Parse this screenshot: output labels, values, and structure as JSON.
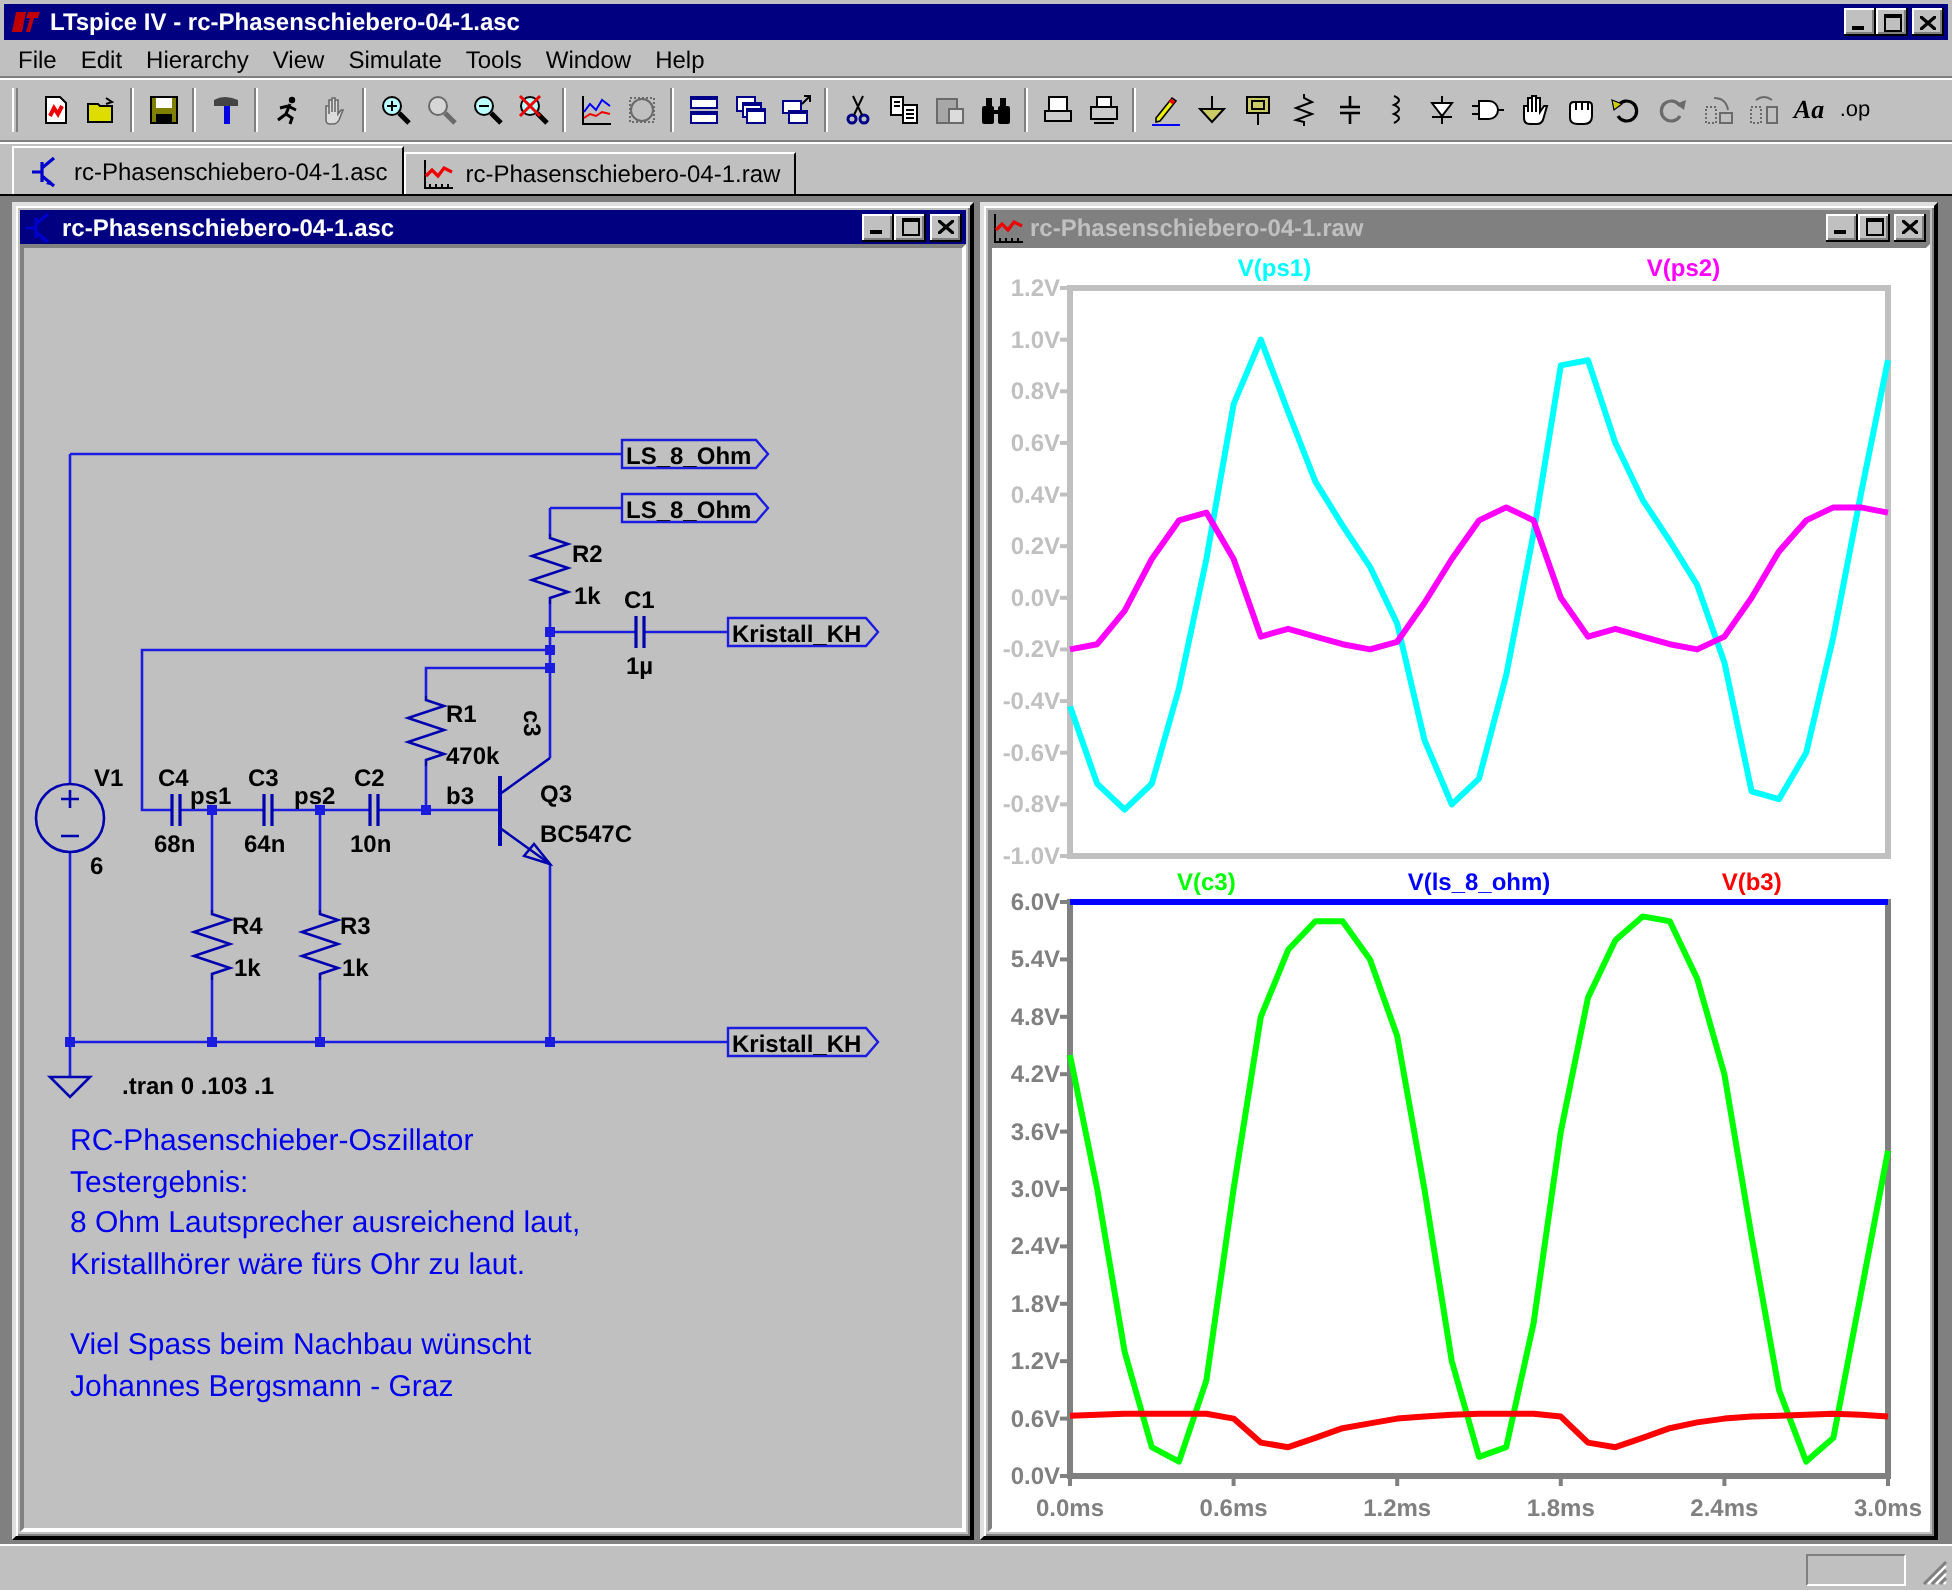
{
  "window": {
    "title": "LTspice IV - rc-Phasenschiebero-04-1.asc"
  },
  "menu": [
    "File",
    "Edit",
    "Hierarchy",
    "View",
    "Simulate",
    "Tools",
    "Window",
    "Help"
  ],
  "toolbar": [
    [
      {
        "kind": "new",
        "disabled": false
      },
      {
        "kind": "open",
        "disabled": false
      }
    ],
    [
      {
        "kind": "save",
        "disabled": false
      }
    ],
    [
      {
        "kind": "hammer",
        "disabled": false
      }
    ],
    [
      {
        "kind": "run",
        "disabled": false
      },
      {
        "kind": "halt",
        "disabled": true
      }
    ],
    [
      {
        "kind": "zoom-in",
        "disabled": false
      },
      {
        "kind": "zoom-fit",
        "disabled": true
      },
      {
        "kind": "zoom-out",
        "disabled": false
      },
      {
        "kind": "zoom-cancel",
        "disabled": false
      }
    ],
    [
      {
        "kind": "plot-settings",
        "disabled": false
      },
      {
        "kind": "autorange",
        "disabled": true
      }
    ],
    [
      {
        "kind": "tile",
        "disabled": false
      },
      {
        "kind": "cascade",
        "disabled": false
      },
      {
        "kind": "arrange",
        "disabled": false
      }
    ],
    [
      {
        "kind": "cut",
        "disabled": false
      },
      {
        "kind": "copy",
        "disabled": false
      },
      {
        "kind": "paste",
        "disabled": true
      },
      {
        "kind": "find",
        "disabled": false
      }
    ],
    [
      {
        "kind": "preview",
        "disabled": false
      },
      {
        "kind": "print",
        "disabled": false
      }
    ],
    [
      {
        "kind": "pencil",
        "disabled": false
      },
      {
        "kind": "ground",
        "disabled": false
      },
      {
        "kind": "label",
        "disabled": false
      },
      {
        "kind": "resistor",
        "disabled": false
      },
      {
        "kind": "capacitor",
        "disabled": false
      },
      {
        "kind": "inductor",
        "disabled": false
      },
      {
        "kind": "diode",
        "disabled": false
      },
      {
        "kind": "component",
        "disabled": false
      },
      {
        "kind": "move",
        "disabled": false
      },
      {
        "kind": "drag",
        "disabled": false
      },
      {
        "kind": "undo",
        "disabled": false
      },
      {
        "kind": "redo",
        "disabled": true
      },
      {
        "kind": "rotate",
        "disabled": true
      },
      {
        "kind": "mirror",
        "disabled": true
      },
      {
        "kind": "text",
        "label": "Aa",
        "disabled": false
      },
      {
        "kind": "text",
        "label": ".op",
        "disabled": false
      }
    ]
  ],
  "tabs": [
    {
      "label": "rc-Phasenschiebero-04-1.asc",
      "kind": "schematic",
      "selected": true
    },
    {
      "label": "rc-Phasenschiebero-04-1.raw",
      "kind": "waveform",
      "selected": false
    }
  ],
  "schematic_window": {
    "title": "rc-Phasenschiebero-04-1.asc",
    "active": true,
    "components": [
      {
        "kind": "voltage-source",
        "name": "V1",
        "value": "6"
      },
      {
        "kind": "capacitor",
        "name": "C4",
        "value": "68n"
      },
      {
        "kind": "capacitor",
        "name": "C3",
        "value": "64n"
      },
      {
        "kind": "capacitor",
        "name": "C2",
        "value": "10n"
      },
      {
        "kind": "resistor",
        "name": "R1",
        "value": "470k"
      },
      {
        "kind": "resistor",
        "name": "R2",
        "value": "1k"
      },
      {
        "kind": "capacitor",
        "name": "C1",
        "value": "1µ"
      },
      {
        "kind": "npn",
        "name": "Q3",
        "value": "BC547C"
      },
      {
        "kind": "resistor",
        "name": "R4",
        "value": "1k"
      },
      {
        "kind": "resistor",
        "name": "R3",
        "value": "1k"
      }
    ],
    "node_labels": [
      "ps1",
      "ps2",
      "b3",
      "c3"
    ],
    "net_labels": [
      "LS_8_Ohm",
      "LS_8_Ohm",
      "Kristall_KH",
      "Kristall_KH"
    ],
    "directive": ".tran 0 .103 .1",
    "comment": [
      "RC-Phasenschieber-Oszillator",
      "Testergebnis:",
      "8 Ohm Lautsprecher ausreichend laut,",
      "Kristallhörer wäre fürs Ohr zu laut.",
      "Viel Spass beim Nachbau wünscht",
      "Johannes Bergsmann - Graz"
    ]
  },
  "plot_window": {
    "title": "rc-Phasenschiebero-04-1.raw",
    "active": false,
    "panes": [
      {
        "chart_data": {
          "type": "line",
          "x": [
            0,
            0.1,
            0.2,
            0.3,
            0.4,
            0.5,
            0.6,
            0.7,
            0.8,
            0.9,
            1.0,
            1.1,
            1.2,
            1.3,
            1.4,
            1.5,
            1.6,
            1.7,
            1.8,
            1.9,
            2.0,
            2.1,
            2.2,
            2.3,
            2.4,
            2.5,
            2.6,
            2.7,
            2.8,
            2.9,
            3.0
          ],
          "xlim": [
            0,
            3
          ],
          "ylim": [
            -1.0,
            1.2
          ],
          "yticks": [
            {
              "value": 1.2,
              "label": "1.2V"
            },
            {
              "value": 1.0,
              "label": "1.0V"
            },
            {
              "value": 0.8,
              "label": "0.8V"
            },
            {
              "value": 0.6,
              "label": "0.6V"
            },
            {
              "value": 0.4,
              "label": "0.4V"
            },
            {
              "value": 0.2,
              "label": "0.2V"
            },
            {
              "value": 0,
              "label": "0.0V"
            },
            {
              "value": -0.2,
              "label": "-0.2V"
            },
            {
              "value": -0.4,
              "label": "-0.4V"
            },
            {
              "value": -0.6,
              "label": "-0.6V"
            },
            {
              "value": -0.8,
              "label": "-0.8V"
            },
            {
              "value": -1.0,
              "label": "-1.0V"
            }
          ],
          "series": [
            {
              "name": "V(ps1)",
              "color": "#00ffff",
              "values": [
                -0.42,
                -0.72,
                -0.82,
                -0.72,
                -0.35,
                0.15,
                0.75,
                1.0,
                0.72,
                0.45,
                0.28,
                0.12,
                -0.1,
                -0.55,
                -0.8,
                -0.7,
                -0.3,
                0.25,
                0.9,
                0.92,
                0.6,
                0.38,
                0.22,
                0.05,
                -0.25,
                -0.75,
                -0.78,
                -0.6,
                -0.15,
                0.4,
                0.92
              ]
            },
            {
              "name": "V(ps2)",
              "color": "#ff00ff",
              "values": [
                -0.2,
                -0.18,
                -0.05,
                0.15,
                0.3,
                0.33,
                0.15,
                -0.15,
                -0.12,
                -0.15,
                -0.18,
                -0.2,
                -0.17,
                -0.02,
                0.15,
                0.3,
                0.35,
                0.3,
                0.0,
                -0.15,
                -0.12,
                -0.15,
                -0.18,
                -0.2,
                -0.15,
                0.0,
                0.18,
                0.3,
                0.35,
                0.35,
                0.33
              ]
            }
          ]
        }
      },
      {
        "chart_data": {
          "type": "line",
          "x": [
            0,
            0.1,
            0.2,
            0.3,
            0.4,
            0.5,
            0.6,
            0.7,
            0.8,
            0.9,
            1.0,
            1.1,
            1.2,
            1.3,
            1.4,
            1.5,
            1.6,
            1.7,
            1.8,
            1.9,
            2.0,
            2.1,
            2.2,
            2.3,
            2.4,
            2.5,
            2.6,
            2.7,
            2.8,
            2.9,
            3.0
          ],
          "xlim": [
            0,
            3
          ],
          "ylim": [
            0,
            6
          ],
          "xticks": [
            {
              "value": 0,
              "label": "0.0ms"
            },
            {
              "value": 0.6,
              "label": "0.6ms"
            },
            {
              "value": 1.2,
              "label": "1.2ms"
            },
            {
              "value": 1.8,
              "label": "1.8ms"
            },
            {
              "value": 2.4,
              "label": "2.4ms"
            },
            {
              "value": 3.0,
              "label": "3.0ms"
            }
          ],
          "yticks": [
            {
              "value": 6,
              "label": "6.0V"
            },
            {
              "value": 5.4,
              "label": "5.4V"
            },
            {
              "value": 4.8,
              "label": "4.8V"
            },
            {
              "value": 4.2,
              "label": "4.2V"
            },
            {
              "value": 3.6,
              "label": "3.6V"
            },
            {
              "value": 3.0,
              "label": "3.0V"
            },
            {
              "value": 2.4,
              "label": "2.4V"
            },
            {
              "value": 1.8,
              "label": "1.8V"
            },
            {
              "value": 1.2,
              "label": "1.2V"
            },
            {
              "value": 0.6,
              "label": "0.6V"
            },
            {
              "value": 0,
              "label": "0.0V"
            }
          ],
          "series": [
            {
              "name": "V(c3)",
              "color": "#00ff00",
              "values": [
                4.4,
                3.0,
                1.3,
                0.3,
                0.15,
                1.0,
                3.0,
                4.8,
                5.5,
                5.8,
                5.8,
                5.4,
                4.6,
                3.0,
                1.2,
                0.2,
                0.3,
                1.6,
                3.6,
                5.0,
                5.6,
                5.85,
                5.8,
                5.2,
                4.2,
                2.5,
                0.9,
                0.15,
                0.4,
                1.9,
                3.4
              ]
            },
            {
              "name": "V(ls_8_ohm)",
              "color": "#0000ff",
              "values": [
                6,
                6,
                6,
                6,
                6,
                6,
                6,
                6,
                6,
                6,
                6,
                6,
                6,
                6,
                6,
                6,
                6,
                6,
                6,
                6,
                6,
                6,
                6,
                6,
                6,
                6,
                6,
                6,
                6,
                6,
                6
              ]
            },
            {
              "name": "V(b3)",
              "color": "#ff0000",
              "values": [
                0.63,
                0.64,
                0.65,
                0.65,
                0.65,
                0.65,
                0.6,
                0.35,
                0.3,
                0.4,
                0.5,
                0.55,
                0.6,
                0.62,
                0.64,
                0.65,
                0.65,
                0.65,
                0.62,
                0.35,
                0.3,
                0.4,
                0.5,
                0.56,
                0.6,
                0.62,
                0.63,
                0.64,
                0.65,
                0.64,
                0.62
              ]
            }
          ]
        }
      }
    ]
  }
}
